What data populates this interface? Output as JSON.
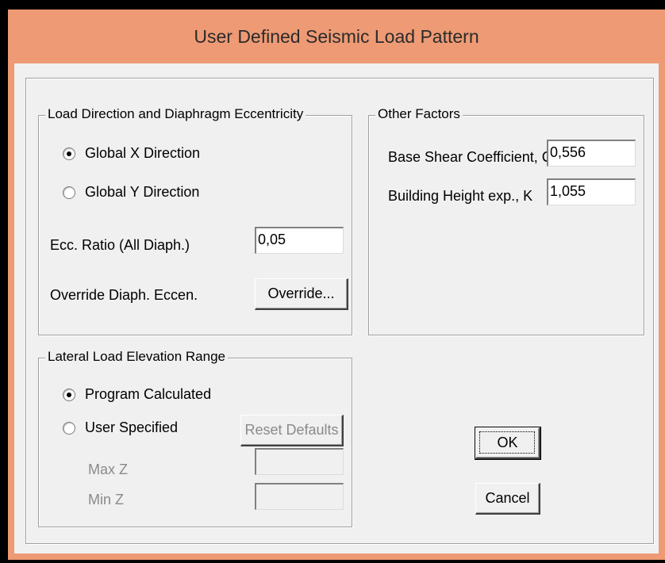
{
  "window": {
    "title": "User Defined Seismic Load Pattern"
  },
  "load_direction": {
    "legend": "Load Direction and Diaphragm Eccentricity",
    "options": [
      {
        "label": "Global X Direction",
        "selected": true
      },
      {
        "label": "Global Y Direction",
        "selected": false
      }
    ],
    "ecc_ratio_label": "Ecc. Ratio (All Diaph.)",
    "ecc_ratio_value": "0,05",
    "override_label": "Override Diaph. Eccen.",
    "override_button": "Override..."
  },
  "other_factors": {
    "legend": "Other Factors",
    "base_shear_label": "Base Shear Coefficient, C",
    "base_shear_value": "0,556",
    "building_height_label": "Building Height exp., K",
    "building_height_value": "1,055"
  },
  "elevation_range": {
    "legend": "Lateral Load Elevation Range",
    "options": [
      {
        "label": "Program Calculated",
        "selected": true
      },
      {
        "label": "User Specified",
        "selected": false
      }
    ],
    "reset_button": "Reset Defaults",
    "max_z_label": "Max Z",
    "max_z_value": "",
    "min_z_label": "Min Z",
    "min_z_value": ""
  },
  "buttons": {
    "ok": "OK",
    "cancel": "Cancel"
  }
}
